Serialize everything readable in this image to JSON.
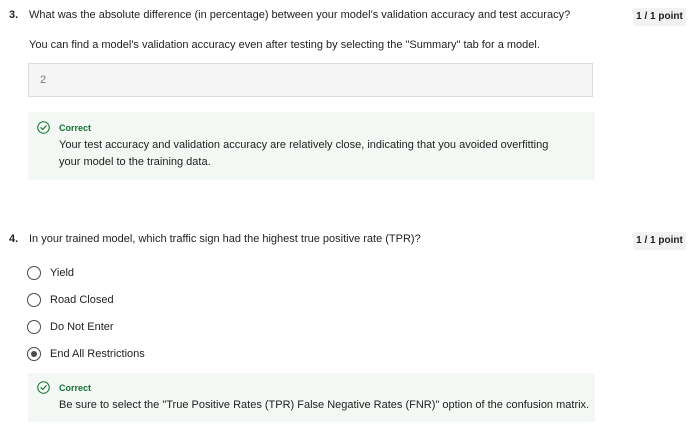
{
  "q3": {
    "number": "3.",
    "question": "What was the absolute difference (in percentage) between your model's validation accuracy and test accuracy?",
    "points": "1 / 1 point",
    "hint": "You can find a model's validation accuracy even after testing by selecting the \"Summary\" tab for a model.",
    "answer_value": "2",
    "feedback": {
      "status": "Correct",
      "line1": "Your test accuracy and validation accuracy are relatively close, indicating that you avoided overfitting",
      "line2": "your model to the training data.",
      "icon": "check-circle-icon",
      "color": "#137333"
    }
  },
  "q4": {
    "number": "4.",
    "question": "In your trained model, which traffic sign had the highest true positive rate (TPR)?",
    "points": "1 / 1 point",
    "options": [
      {
        "label": "Yield",
        "selected": false
      },
      {
        "label": "Road Closed",
        "selected": false
      },
      {
        "label": "Do Not Enter",
        "selected": false
      },
      {
        "label": "End All Restrictions",
        "selected": true
      }
    ],
    "feedback": {
      "status": "Correct",
      "text": "Be sure to select the \"True Positive Rates (TPR) False Negative Rates (FNR)\" option of the confusion matrix.",
      "icon": "check-circle-icon",
      "color": "#137333"
    }
  }
}
